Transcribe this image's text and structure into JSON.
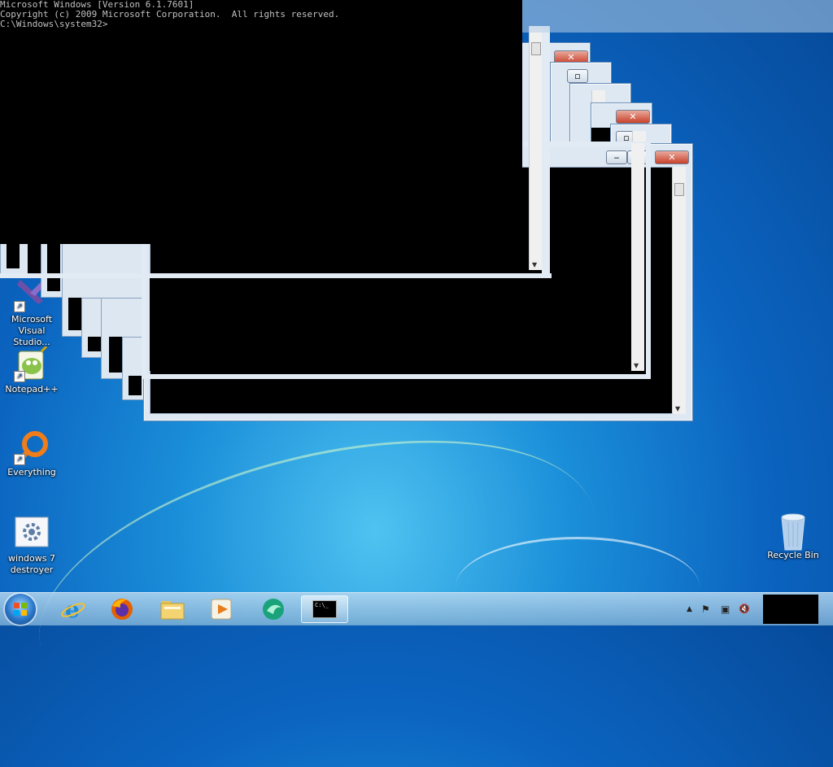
{
  "console": {
    "lines": [
      "Microsoft Windows [Version 6.1.7601]",
      "Copyright (c) 2009 Microsoft Corporation.  All rights reserved.",
      "",
      "C:\\Windows\\system32>"
    ]
  },
  "desktop_icons": [
    {
      "label": "Microsoft Visual Studio...",
      "icon": "visual-studio-icon"
    },
    {
      "label": "Notepad++",
      "icon": "notepad-plus-plus-icon"
    },
    {
      "label": "Everything",
      "icon": "everything-search-icon"
    },
    {
      "label": "windows 7 destroyer",
      "icon": "gear-program-icon"
    },
    {
      "label": "Recycle Bin",
      "icon": "recycle-bin-icon"
    }
  ],
  "window_controls": {
    "minimize": "‒",
    "maximize": "▫",
    "close": "✕"
  },
  "taskbar": {
    "pinned": [
      {
        "name": "internet-explorer",
        "icon": "internet-explorer-icon"
      },
      {
        "name": "firefox",
        "icon": "firefox-icon"
      },
      {
        "name": "file-explorer",
        "icon": "folder-icon"
      },
      {
        "name": "media-player",
        "icon": "media-player-icon"
      },
      {
        "name": "browser-green",
        "icon": "green-app-icon"
      },
      {
        "name": "command-prompt",
        "icon": "cmd-icon",
        "active": true
      }
    ],
    "cmd_glyph": "C:\\_",
    "tray": {
      "show_hidden": "▲",
      "flag": "⚑",
      "network": "▣",
      "volume_muted": "🔇"
    }
  },
  "colors": {
    "desktop": "#0b64c0",
    "console_text": "#c0c0c0",
    "close_red": "#c8402b"
  }
}
